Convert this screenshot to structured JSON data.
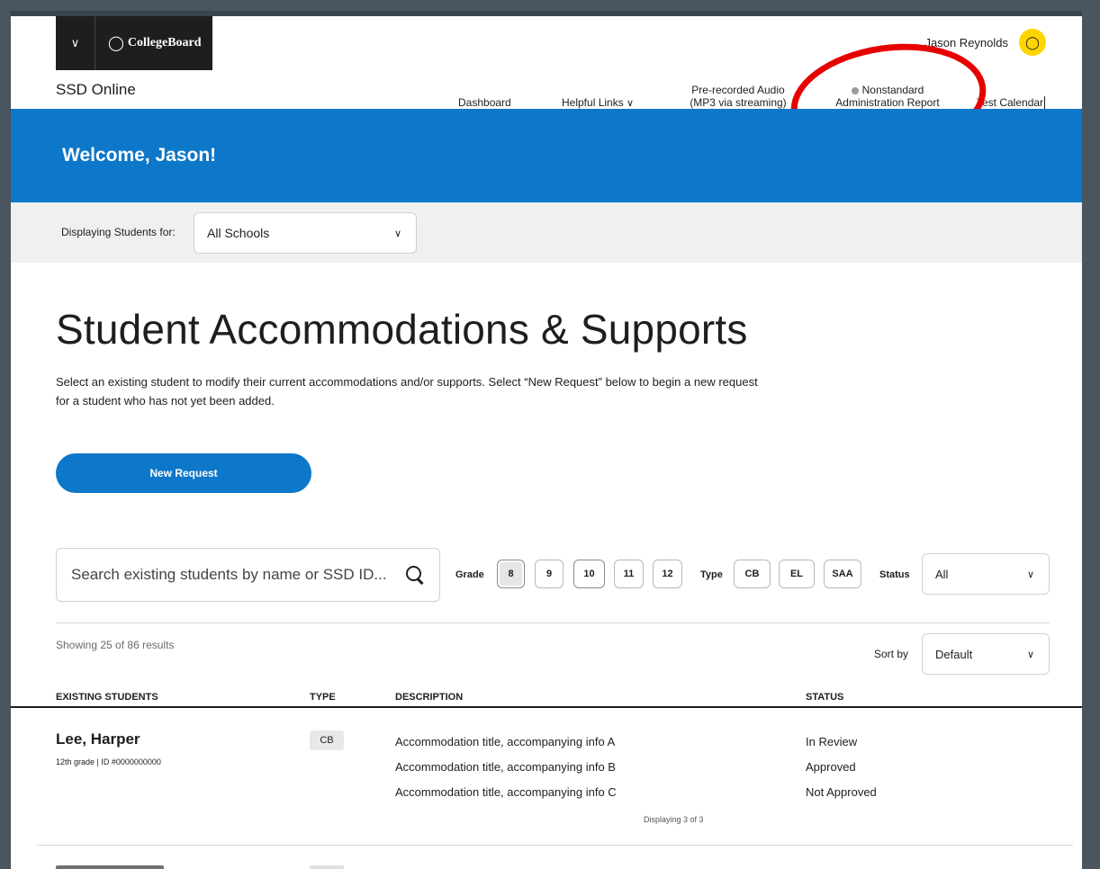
{
  "header": {
    "brand": "CollegeBoard",
    "app_title": "SSD Online",
    "user_name": "Jason Reynolds"
  },
  "nav": {
    "dashboard": "Dashboard",
    "helpful_links": "Helpful Links",
    "audio_line1": "Pre-recorded Audio",
    "audio_line2": "(MP3 via streaming)",
    "report_line1": "Nonstandard",
    "report_line2": "Administration Report",
    "test_calendar": "Test Calendar"
  },
  "welcome": "Welcome, Jason!",
  "filter": {
    "label": "Displaying Students for:",
    "school": "All Schools"
  },
  "main": {
    "title": "Student Accommodations & Supports",
    "intro": "Select an existing student to modify their current accommodations and/or supports. Select “New Request” below to begin a new request for a student who has not yet been added.",
    "new_request": "New Request",
    "search_placeholder": "Search existing students by name or SSD ID..."
  },
  "filters": {
    "grade_label": "Grade",
    "grades": [
      "8",
      "9",
      "10",
      "11",
      "12"
    ],
    "type_label": "Type",
    "types": [
      "CB",
      "EL",
      "SAA"
    ],
    "status_label": "Status",
    "status_value": "All"
  },
  "results": {
    "count": "Showing 25 of 86 results",
    "sort_label": "Sort by",
    "sort_value": "Default"
  },
  "table": {
    "headers": [
      "EXISTING STUDENTS",
      "TYPE",
      "DESCRIPTION",
      "STATUS"
    ],
    "rows": [
      {
        "name": "Lee, Harper",
        "meta": "12th grade  |  ID #0000000000",
        "type": "CB",
        "descriptions": [
          "Accommodation title, accompanying info A",
          "Accommodation title, accompanying info B",
          "Accommodation title, accompanying info C"
        ],
        "statuses": [
          "In Review",
          "Approved",
          "Not Approved"
        ],
        "displaying": "Displaying 3 of 3"
      }
    ]
  }
}
